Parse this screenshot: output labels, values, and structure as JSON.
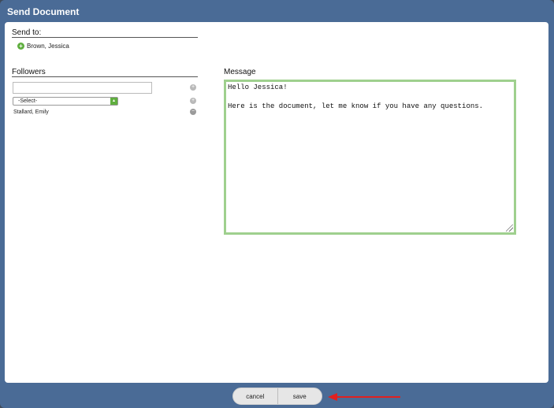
{
  "dialog": {
    "title": "Send Document"
  },
  "send_to": {
    "label": "Send to:",
    "recipients": [
      "Brown, Jessica"
    ]
  },
  "followers": {
    "label": "Followers",
    "input_value": "",
    "select_value": "-Select-",
    "list": [
      "Stallard, Emily"
    ]
  },
  "message": {
    "label": "Message",
    "body": "Hello Jessica!\n\nHere is the document, let me know if you have any questions."
  },
  "footer": {
    "cancel_label": "cancel",
    "save_label": "save"
  },
  "colors": {
    "frame": "#4a6b96",
    "accent_green": "#5fae3e",
    "textarea_border": "#9fd08e",
    "annotation_arrow": "#e02020"
  },
  "icons": {
    "recipient": "plus-circle-icon",
    "add": "plus-circle-icon",
    "remove": "minus-circle-icon",
    "select": "chevron-updown-icon",
    "annotation": "red-arrow-icon"
  }
}
